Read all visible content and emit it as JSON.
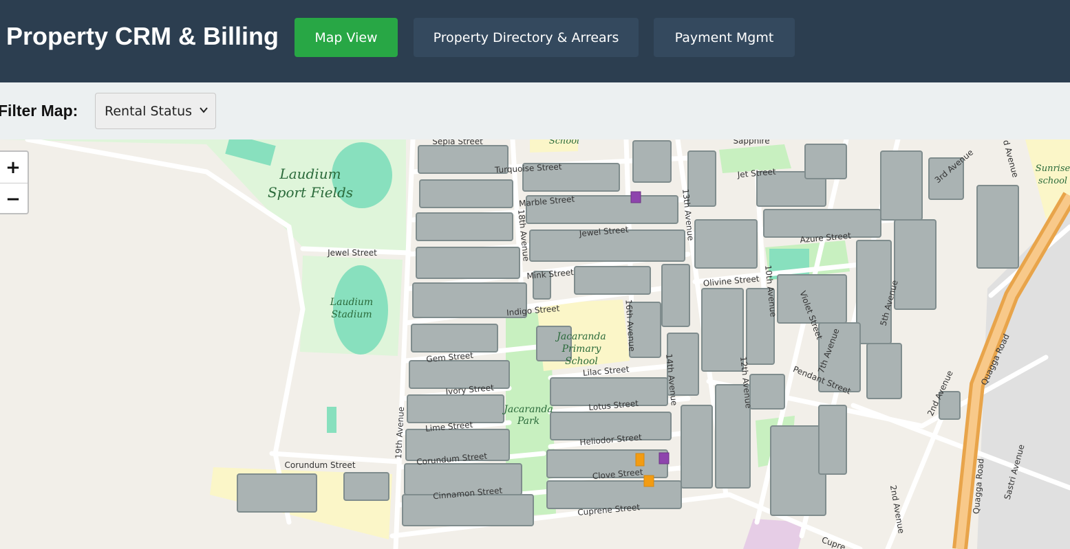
{
  "header": {
    "title": "Property CRM & Billing",
    "nav": {
      "map_view": "Map View",
      "directory": "Property Directory & Arrears",
      "payments": "Payment Mgmt"
    }
  },
  "filter": {
    "label": "Filter Map:",
    "selected": "Rental Status"
  },
  "map": {
    "zoom_in": "+",
    "zoom_out": "−",
    "streets": {
      "sepia": "Sepia Street",
      "turquoise": "Turquoise Street",
      "marble": "Marble Street",
      "jewel1": "Jewel Street",
      "jewel2": "Jewel Street",
      "mink": "Mink Street",
      "indigo": "Indigo Street",
      "gem": "Gem Street",
      "ivory": "Ivory Street",
      "lime": "Lime Street",
      "corundum1": "Corundum Street",
      "corundum2": "Corundum Street",
      "cinnamon": "Cinnamon Street",
      "clove": "Clove Street",
      "heliodor": "Heliodor Street",
      "lotus": "Lotus Street",
      "lilac": "Lilac Street",
      "cuprene": "Cuprene Street",
      "cuprene2": "Cupre",
      "jet": "Jet Street",
      "sapphire": "Sapphire",
      "azure": "Azure Street",
      "olivine": "Olivine Street",
      "pendant": "Pendant Street",
      "violet": "Violet Street",
      "ave19": "19th Avenue",
      "ave18": "18th Avenue",
      "ave16": "16th Avenue",
      "ave14": "14th Avenue",
      "ave13": "13th Avenue",
      "ave12": "12th Avenue",
      "ave10": "10th Avenue",
      "ave7": "7th Avenue",
      "ave5": "5th Avenue",
      "ave3": "3rd Avenue",
      "ave2a": "2nd Avenue",
      "ave2b": "2nd Avenue",
      "ave_top": "d Avenue",
      "quagga1": "Quagga Road",
      "quagga2": "Quagga Road",
      "sastri": "Sastri Avenue"
    },
    "places": {
      "sport_fields_1": "Laudium",
      "sport_fields_2": "Sport Fields",
      "stadium_1": "Laudium",
      "stadium_2": "Stadium",
      "park_1": "Jacaranda",
      "park_2": "Park",
      "school_1": "Jacaranda",
      "school_2": "Primary",
      "school_3": "School",
      "school_top": "School",
      "sunrise_1": "Sunrise",
      "sunrise_2": "school"
    }
  },
  "colors": {
    "header_bg": "#2c3e50",
    "map_view_active": "#28a745",
    "nav_inactive": "#34495e",
    "building": "#8d9a9a",
    "marker_purple": "#8e44ad",
    "marker_orange": "#f39c12"
  }
}
